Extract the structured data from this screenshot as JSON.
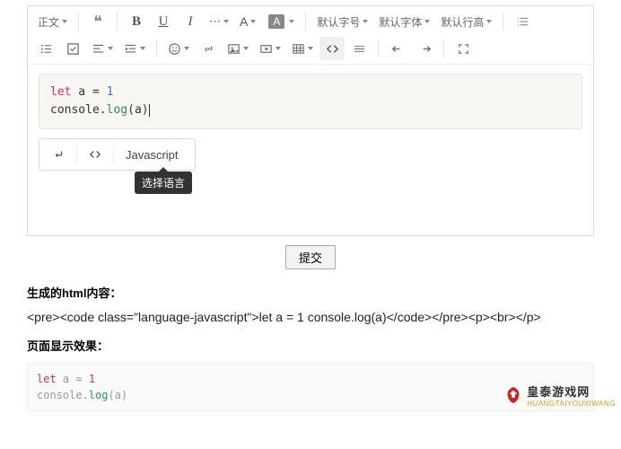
{
  "toolbar": {
    "row1": {
      "paragraph_label": "正文",
      "font_size_label": "默认字号",
      "font_family_label": "默认字体",
      "line_height_label": "默认行高",
      "bold": "B",
      "underline": "U",
      "italic": "I",
      "more": "⋯",
      "letterA": "A",
      "boxA": "A"
    }
  },
  "code": {
    "line1_kw": "let",
    "line1_var": " a ",
    "line1_eq": "= ",
    "line1_num": "1",
    "line2_obj": "console.",
    "line2_fn": "log",
    "line2_open": "(",
    "line2_arg": "a",
    "line2_close": ")"
  },
  "code_toolbar": {
    "language": "Javascript",
    "tooltip": "选择语言"
  },
  "submit_label": "提交",
  "sections": {
    "html_title": "生成的html内容：",
    "render_title": "页面显示效果："
  },
  "html_output": "<pre><code class=\"language-javascript\">let a = 1 console.log(a)</code></pre><p><br></p>",
  "render": {
    "line1_kw": "let",
    "line1_rest": " a = ",
    "line1_num": "1",
    "line2_obj": "console.",
    "line2_fn": "log",
    "line2_rest": "(a)"
  },
  "watermark": {
    "main": "皇泰游戏网",
    "sub": "HUANGTAIYOUXIWANG"
  }
}
